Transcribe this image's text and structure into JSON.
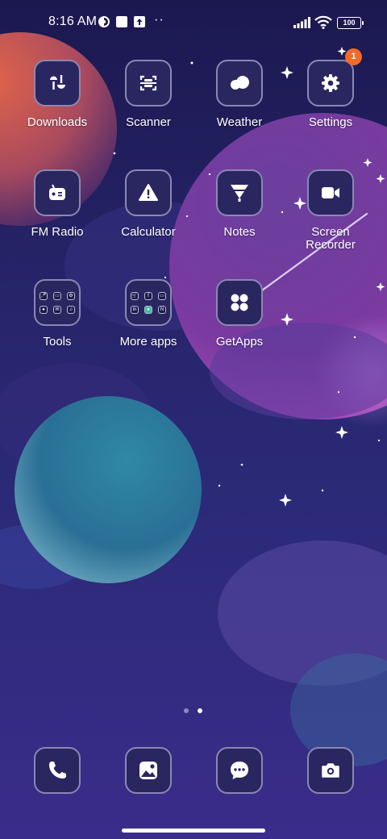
{
  "status_bar": {
    "time": "8:16 AM",
    "overflow": "··",
    "battery": "100",
    "icons": [
      "data-saver-icon",
      "notification-square-icon",
      "upload-icon",
      "signal-icon",
      "wifi-icon",
      "battery-icon"
    ]
  },
  "apps": [
    {
      "label": "Downloads",
      "icon": "downloads-icon"
    },
    {
      "label": "Scanner",
      "icon": "scanner-icon"
    },
    {
      "label": "Weather",
      "icon": "weather-icon"
    },
    {
      "label": "Settings",
      "icon": "gear-icon",
      "badge": "1"
    },
    {
      "label": "FM Radio",
      "icon": "radio-icon"
    },
    {
      "label": "Calculator",
      "icon": "calculator-icon"
    },
    {
      "label": "Notes",
      "icon": "notes-icon"
    },
    {
      "label": "Screen Recorder",
      "icon": "video-camera-icon"
    },
    {
      "label": "Tools",
      "icon": "folder-icon"
    },
    {
      "label": "More apps",
      "icon": "folder-icon"
    },
    {
      "label": "GetApps",
      "icon": "getapps-icon"
    }
  ],
  "folders": {
    "tools_mini_glyphs": [
      "🎤",
      "▭",
      "⚙",
      "♠",
      "✉",
      "♫"
    ],
    "more_apps_mini_glyphs": [
      "🛒",
      "f",
      "▭",
      "in",
      "●",
      "N"
    ]
  },
  "page_indicator": {
    "pages": 2,
    "active_index": 1
  },
  "dock": [
    "phone-icon",
    "gallery-icon",
    "messages-icon",
    "camera-icon"
  ],
  "colors": {
    "badge": "#f06a2a",
    "icon_border": "#8a88b4",
    "icon_fill": "#2a2660"
  }
}
